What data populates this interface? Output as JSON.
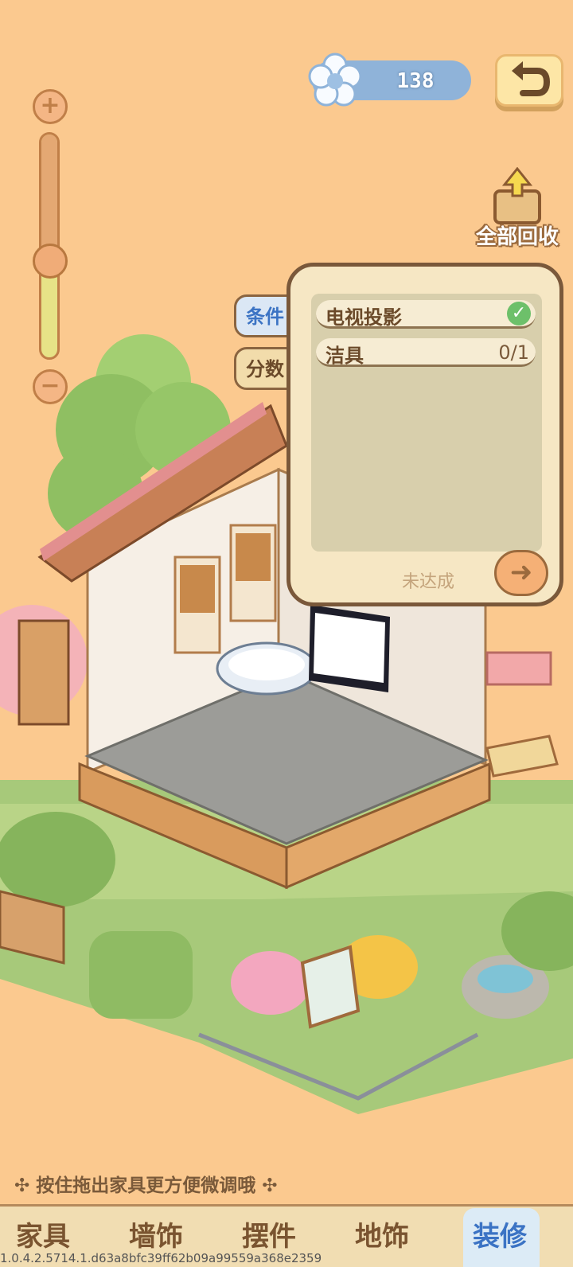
{
  "currency": {
    "value": "138",
    "icon": "flower-icon"
  },
  "header": {
    "back_icon": "undo-arrow-icon"
  },
  "zoom": {
    "plus": "+",
    "minus": "−",
    "level": 0.5
  },
  "recycle": {
    "label": "全部回收",
    "icon": "recycle-box-icon"
  },
  "side_tabs": {
    "conditions": "条件",
    "score": "分数"
  },
  "panel": {
    "conditions": [
      {
        "label": "电视投影",
        "done": true
      },
      {
        "label": "洁具",
        "value": "0/1"
      }
    ],
    "status": "未达成",
    "next_icon": "arrow-right-icon"
  },
  "hint": "按住拖出家具更方便微调哦",
  "nav": {
    "items": [
      "家具",
      "墙饰",
      "摆件",
      "地饰",
      "装修"
    ],
    "selected": "装修"
  },
  "version": "1.0.4.2.5714.1.d63a8bfc39ff62b09a99559a368e2359",
  "colors": {
    "background": "#fbc98f",
    "accent_blue": "#3b73c4",
    "panel": "#f6e7c4",
    "brown": "#7a583a"
  }
}
